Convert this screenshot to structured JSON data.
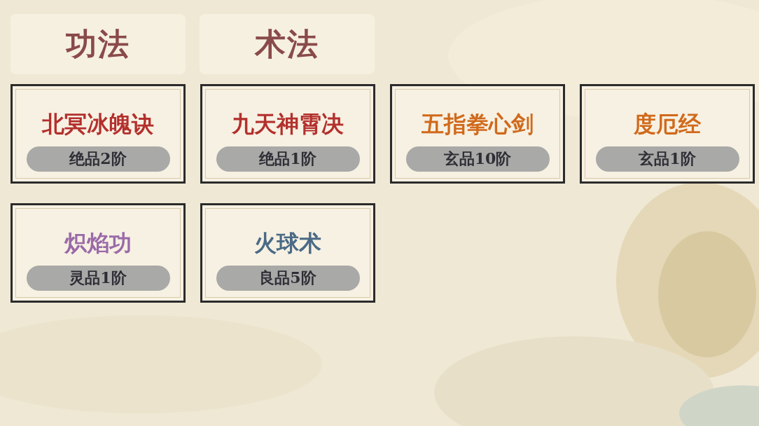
{
  "tabs": [
    {
      "label": "功法"
    },
    {
      "label": "术法"
    }
  ],
  "cards": [
    {
      "name": "北冥冰魄诀",
      "color": "#b3302d",
      "grade": "绝品2阶"
    },
    {
      "name": "九天神霄决",
      "color": "#b3302d",
      "grade": "绝品1阶"
    },
    {
      "name": "五指拳心剑",
      "color": "#d06a1c",
      "grade": "玄品10阶"
    },
    {
      "name": "度厄经",
      "color": "#d06a1c",
      "grade": "玄品1阶"
    },
    {
      "name": "炽焰功",
      "color": "#9a6aa8",
      "grade": "灵品1阶"
    },
    {
      "name": "火球术",
      "color": "#4a6a86",
      "grade": "良品5阶"
    }
  ]
}
